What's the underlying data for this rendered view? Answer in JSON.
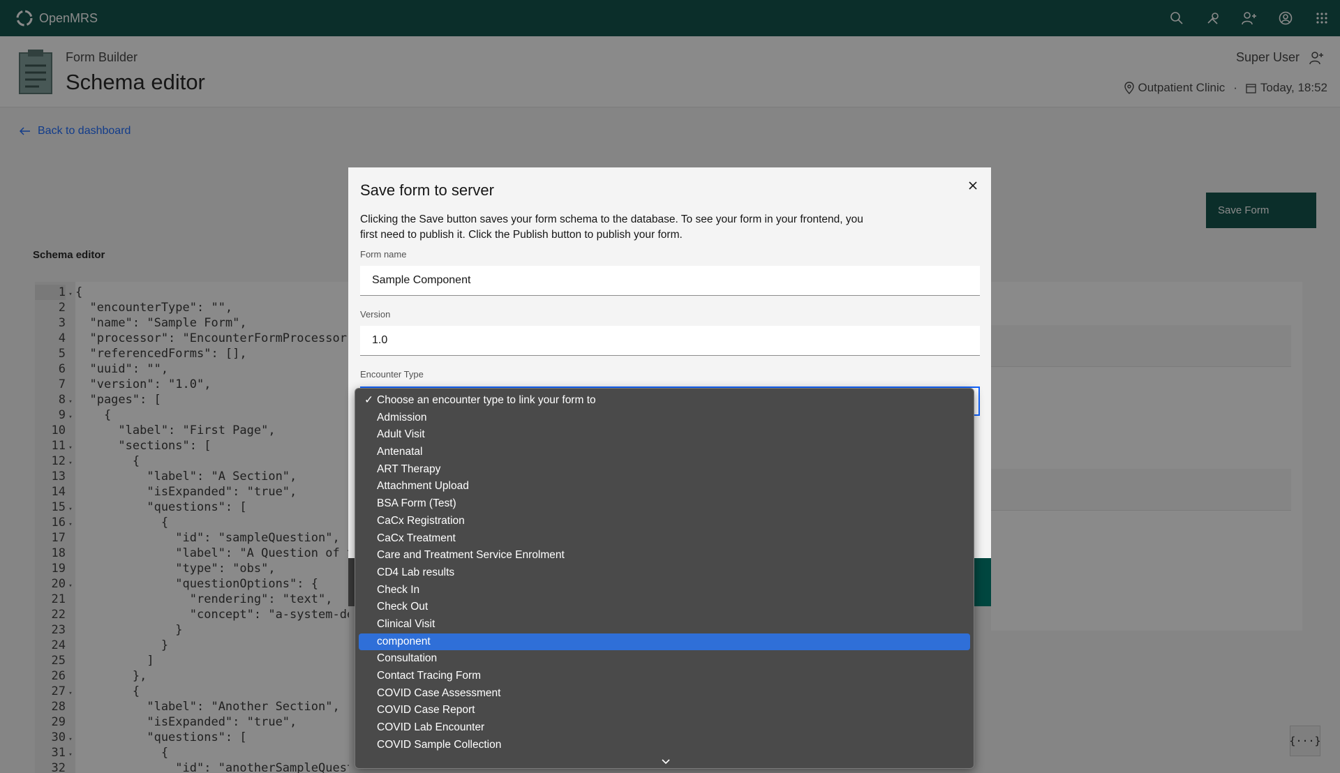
{
  "header": {
    "brand": "OpenMRS",
    "icons": [
      "search-icon",
      "tools-icon",
      "add-user-icon",
      "user-avatar-icon",
      "app-switcher-icon"
    ]
  },
  "page_header": {
    "app_name": "Form Builder",
    "title": "Schema editor",
    "user": "Super User",
    "location": "Outpatient Clinic",
    "datetime": "Today, 18:52"
  },
  "back_link": "Back to dashboard",
  "save_form_button": "Save Form",
  "schema_editor_label": "Schema editor",
  "code_lines": [
    {
      "n": "1",
      "fold": true,
      "text": "{"
    },
    {
      "n": "2",
      "fold": false,
      "text": "  \"encounterType\": \"\","
    },
    {
      "n": "3",
      "fold": false,
      "text": "  \"name\": \"Sample Form\","
    },
    {
      "n": "4",
      "fold": false,
      "text": "  \"processor\": \"EncounterFormProcessor\","
    },
    {
      "n": "5",
      "fold": false,
      "text": "  \"referencedForms\": [],"
    },
    {
      "n": "6",
      "fold": false,
      "text": "  \"uuid\": \"\","
    },
    {
      "n": "7",
      "fold": false,
      "text": "  \"version\": \"1.0\","
    },
    {
      "n": "8",
      "fold": true,
      "text": "  \"pages\": ["
    },
    {
      "n": "9",
      "fold": true,
      "text": "    {"
    },
    {
      "n": "10",
      "fold": false,
      "text": "      \"label\": \"First Page\","
    },
    {
      "n": "11",
      "fold": true,
      "text": "      \"sections\": ["
    },
    {
      "n": "12",
      "fold": true,
      "text": "        {"
    },
    {
      "n": "13",
      "fold": false,
      "text": "          \"label\": \"A Section\","
    },
    {
      "n": "14",
      "fold": false,
      "text": "          \"isExpanded\": \"true\","
    },
    {
      "n": "15",
      "fold": true,
      "text": "          \"questions\": ["
    },
    {
      "n": "16",
      "fold": true,
      "text": "            {"
    },
    {
      "n": "17",
      "fold": false,
      "text": "              \"id\": \"sampleQuestion\","
    },
    {
      "n": "18",
      "fold": false,
      "text": "              \"label\": \"A Question of ty"
    },
    {
      "n": "19",
      "fold": false,
      "text": "              \"type\": \"obs\","
    },
    {
      "n": "20",
      "fold": true,
      "text": "              \"questionOptions\": {"
    },
    {
      "n": "21",
      "fold": false,
      "text": "                \"rendering\": \"text\","
    },
    {
      "n": "22",
      "fold": false,
      "text": "                \"concept\": \"a-system-defi"
    },
    {
      "n": "23",
      "fold": false,
      "text": "              }"
    },
    {
      "n": "24",
      "fold": false,
      "text": "            }"
    },
    {
      "n": "25",
      "fold": false,
      "text": "          ]"
    },
    {
      "n": "26",
      "fold": false,
      "text": "        },"
    },
    {
      "n": "27",
      "fold": true,
      "text": "        {"
    },
    {
      "n": "28",
      "fold": false,
      "text": "          \"label\": \"Another Section\","
    },
    {
      "n": "29",
      "fold": false,
      "text": "          \"isExpanded\": \"true\","
    },
    {
      "n": "30",
      "fold": true,
      "text": "          \"questions\": ["
    },
    {
      "n": "31",
      "fold": true,
      "text": "            {"
    },
    {
      "n": "32",
      "fold": false,
      "text": "              \"id\": \"anotherSampleQuestion\","
    }
  ],
  "modal": {
    "title": "Save form to server",
    "description": "Clicking the Save button saves your form schema to the database. To see your form in your frontend, you first need to publish it. Click the Publish button to publish your form.",
    "form_name_label": "Form name",
    "form_name_value": "Sample Component",
    "version_label": "Version",
    "version_value": "1.0",
    "encounter_type_label": "Encounter Type"
  },
  "encounter_dropdown": {
    "placeholder": "Choose an encounter type to link your form to",
    "selected": "component",
    "options": [
      "Admission",
      "Adult Visit",
      "Antenatal",
      "ART Therapy",
      "Attachment Upload",
      "BSA Form (Test)",
      "CaCx Registration",
      "CaCx Treatment",
      "Care and Treatment Service Enrolment",
      "CD4 Lab results",
      "Check In",
      "Check Out",
      "Clinical Visit",
      "component",
      "Consultation",
      "Contact Tracing Form",
      "COVID Case Assessment",
      "COVID Case Report",
      "COVID Lab Encounter",
      "COVID Sample Collection"
    ]
  },
  "bottom_right_icon": "{···}",
  "colors": {
    "brand": "#00463f",
    "focus": "#0f62fe",
    "selected_option": "#2f6fd8"
  }
}
